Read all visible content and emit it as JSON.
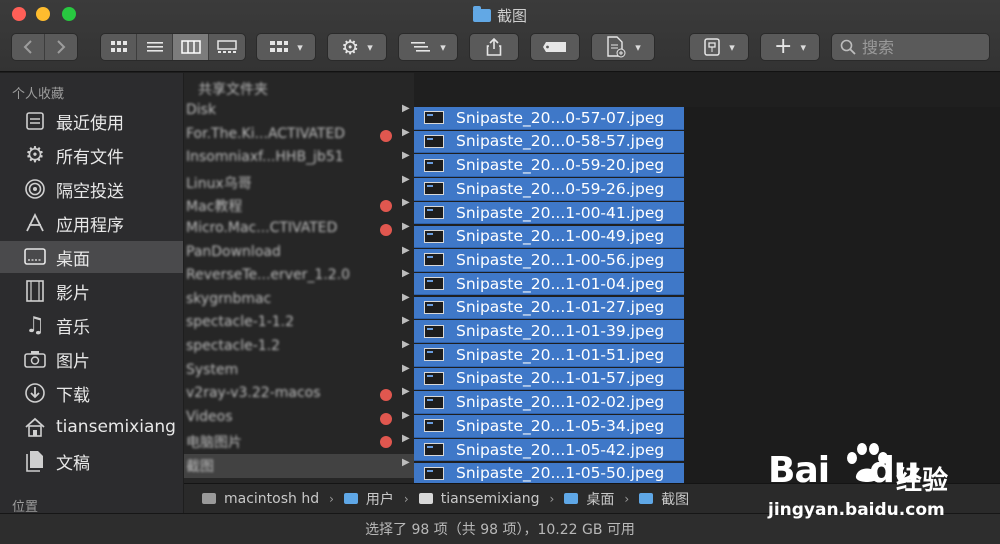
{
  "window": {
    "title": "截图"
  },
  "toolbar": {
    "search_placeholder": "搜索"
  },
  "sidebar": {
    "favorites_header": "个人收藏",
    "locations_header": "位置",
    "items": [
      {
        "label": "最近使用",
        "icon": "clock-list-icon"
      },
      {
        "label": "所有文件",
        "icon": "gear-icon"
      },
      {
        "label": "隔空投送",
        "icon": "airdrop-icon"
      },
      {
        "label": "应用程序",
        "icon": "apps-icon"
      },
      {
        "label": "桌面",
        "icon": "desktop-icon",
        "selected": true
      },
      {
        "label": "影片",
        "icon": "film-icon"
      },
      {
        "label": "音乐",
        "icon": "music-note-icon"
      },
      {
        "label": "图片",
        "icon": "camera-icon"
      },
      {
        "label": "下载",
        "icon": "download-icon"
      },
      {
        "label": "tiansemixiang",
        "icon": "home-icon"
      },
      {
        "label": "文稿",
        "icon": "document-icon"
      }
    ]
  },
  "column1": {
    "header": "共享文件夹",
    "rows": [
      {
        "label": "Disk",
        "tag": false
      },
      {
        "label": "For.The.Ki...ACTIVATED",
        "tag": true
      },
      {
        "label": "Insomniaxf...HHB_jb51",
        "tag": false
      },
      {
        "label": "Linux乌哥",
        "tag": false
      },
      {
        "label": "Mac教程",
        "tag": true
      },
      {
        "label": "Micro.Mac...CTIVATED",
        "tag": true
      },
      {
        "label": "PanDownload",
        "tag": false
      },
      {
        "label": "ReverseTe...erver_1.2.0",
        "tag": false
      },
      {
        "label": "skygrnbmac",
        "tag": false
      },
      {
        "label": "spectacle-1-1.2",
        "tag": false
      },
      {
        "label": "spectacle-1.2",
        "tag": false
      },
      {
        "label": "System",
        "tag": false
      },
      {
        "label": "v2ray-v3.22-macos",
        "tag": true
      },
      {
        "label": "Videos",
        "tag": true
      },
      {
        "label": "电脑图片",
        "tag": true
      },
      {
        "label": "截图",
        "tag": false,
        "selected": true
      }
    ]
  },
  "files": [
    "Snipaste_20...0-57-07.jpeg",
    "Snipaste_20...0-58-57.jpeg",
    "Snipaste_20...0-59-20.jpeg",
    "Snipaste_20...0-59-26.jpeg",
    "Snipaste_20...1-00-41.jpeg",
    "Snipaste_20...1-00-49.jpeg",
    "Snipaste_20...1-00-56.jpeg",
    "Snipaste_20...1-01-04.jpeg",
    "Snipaste_20...1-01-27.jpeg",
    "Snipaste_20...1-01-39.jpeg",
    "Snipaste_20...1-01-51.jpeg",
    "Snipaste_20...1-01-57.jpeg",
    "Snipaste_20...1-02-02.jpeg",
    "Snipaste_20...1-05-34.jpeg",
    "Snipaste_20...1-05-42.jpeg",
    "Snipaste_20...1-05-50.jpeg"
  ],
  "pathbar": [
    {
      "label": "macintosh hd",
      "icon": "disk-icon",
      "color": "#9a9a9a"
    },
    {
      "label": "用户",
      "icon": "folder-icon",
      "color": "#5fa7e6"
    },
    {
      "label": "tiansemixiang",
      "icon": "home-icon",
      "color": "#d8d8d8"
    },
    {
      "label": "桌面",
      "icon": "folder-icon",
      "color": "#5fa7e6"
    },
    {
      "label": "截图",
      "icon": "folder-icon",
      "color": "#5fa7e6"
    }
  ],
  "status": "选择了 98 项（共 98 项），10.22 GB 可用",
  "watermark": {
    "logo_bai": "Bai",
    "logo_du": "du",
    "logo_cn": "经验",
    "url": "jingyan.baidu.com"
  },
  "colors": {
    "selection": "#3f78c8",
    "tag_red": "#e0574f",
    "folder_blue": "#62a8e5"
  }
}
